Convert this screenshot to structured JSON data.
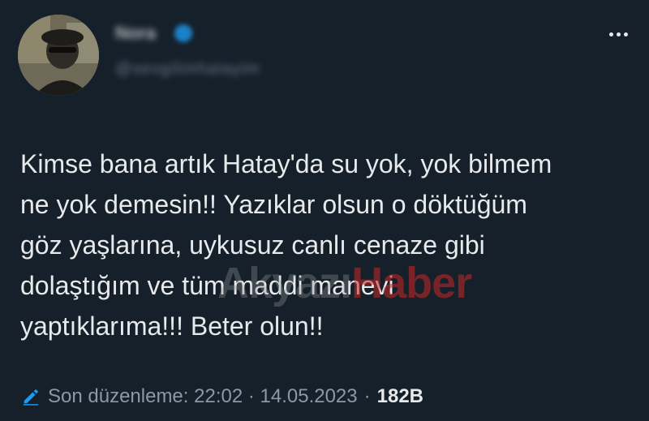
{
  "tweet": {
    "display_name": "Nora",
    "handle": "@sevgilimhatayim",
    "text": "Kimse bana artık Hatay'da su yok, yok bilmem\nne yok demesin!! Yazıklar olsun o döktüğüm\ngöz yaşlarına, uykusuz canlı cenaze gibi\ndolaştığım ve tüm maddi manevi\nyaptıklarıma!!! Beter olun!!",
    "edited_label": "Son düzenleme: 22:02 · 14.05.2023",
    "separator": "·",
    "views": "182B"
  },
  "watermark": {
    "part1": "Akyazı",
    "part2": "Haber"
  },
  "icons": {
    "more": "more-dots-icon",
    "edit": "pencil-icon",
    "verified": "verified-badge-icon"
  },
  "colors": {
    "background": "#15202b",
    "text": "#e7e9ea",
    "muted": "#8b98a5",
    "accent": "#1d9bf0"
  }
}
